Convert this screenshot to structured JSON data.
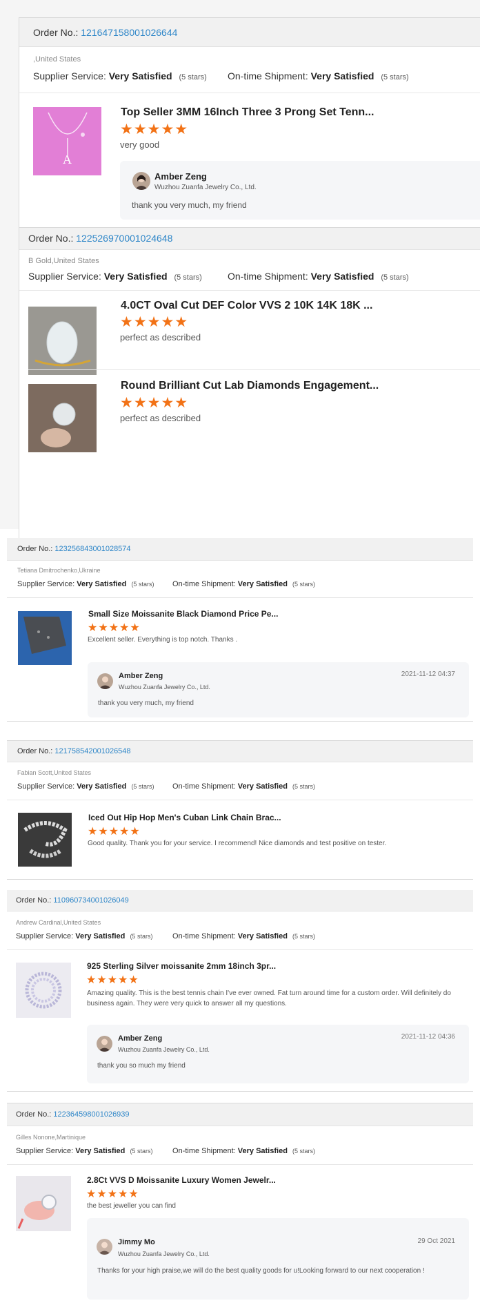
{
  "labels": {
    "order_no": "Order No.:",
    "supplier_service": "Supplier Service:",
    "on_time_shipment": "On-time Shipment:"
  },
  "orders": [
    {
      "order_no": "121647158001026644",
      "location": ",United States",
      "supplier_service": {
        "value": "Very Satisfied",
        "stars_text": "(5 stars)"
      },
      "shipment": {
        "value": "Very Satisfied",
        "stars_text": "(5 stars)"
      },
      "items": [
        {
          "title": "Top Seller 3MM 16Inch Three 3 Prong Set Tenn...",
          "rating": 5,
          "stars": "★★★★★",
          "review": "very good"
        }
      ],
      "reply": {
        "name": "Amber Zeng",
        "company": "Wuzhou Zuanfa Jewelry Co., Ltd.",
        "message": "thank you very much, my friend"
      }
    },
    {
      "order_no": "122526970001024648",
      "location": "B Gold,United States",
      "supplier_service": {
        "value": "Very Satisfied",
        "stars_text": "(5 stars)"
      },
      "shipment": {
        "value": "Very Satisfied",
        "stars_text": "(5 stars)"
      },
      "items": [
        {
          "title": "4.0CT Oval Cut DEF Color VVS 2 10K 14K 18K ...",
          "rating": 5,
          "stars": "★★★★★",
          "review": "perfect as described"
        },
        {
          "title": "Round Brilliant Cut Lab Diamonds Engagement...",
          "rating": 5,
          "stars": "★★★★★",
          "review": "perfect as described"
        }
      ]
    },
    {
      "order_no": "123256843001028574",
      "location": "Tetiana Dmitrochenko,Ukraine",
      "supplier_service": {
        "value": "Very Satisfied",
        "stars_text": "(5 stars)"
      },
      "shipment": {
        "value": "Very Satisfied",
        "stars_text": "(5 stars)"
      },
      "items": [
        {
          "title": "Small Size Moissanite Black Diamond Price Pe...",
          "rating": 5,
          "stars": "★★★★★",
          "review": "Excellent seller. Everything is top notch. Thanks ."
        }
      ],
      "reply": {
        "name": "Amber Zeng",
        "company": "Wuzhou Zuanfa Jewelry Co., Ltd.",
        "date": "2021-11-12 04:37",
        "message": "thank you very much, my friend"
      }
    },
    {
      "order_no": "121758542001026548",
      "location": "Fabian Scott,United States",
      "supplier_service": {
        "value": "Very Satisfied",
        "stars_text": "(5 stars)"
      },
      "shipment": {
        "value": "Very Satisfied",
        "stars_text": "(5 stars)"
      },
      "items": [
        {
          "title": "Iced Out Hip Hop Men's Cuban Link Chain Brac...",
          "rating": 5,
          "stars": "★★★★★",
          "review": "Good quality. Thank you for your service. I recommend! Nice diamonds and test positive on tester."
        }
      ]
    },
    {
      "order_no": "110960734001026049",
      "location": "Andrew Cardinal,United States",
      "supplier_service": {
        "value": "Very Satisfied",
        "stars_text": "(5 stars)"
      },
      "shipment": {
        "value": "Very Satisfied",
        "stars_text": "(5 stars)"
      },
      "items": [
        {
          "title": "925 Sterling Silver moissanite 2mm 18inch 3pr...",
          "rating": 5,
          "stars": "★★★★★",
          "review": "Amazing quality. This is the best tennis chain I've ever owned. Fat turn around time for a custom order. Will definitely do business again. They were very quick to answer all my questions."
        }
      ],
      "reply": {
        "name": "Amber Zeng",
        "company": "Wuzhou Zuanfa Jewelry Co., Ltd.",
        "date": "2021-11-12 04:36",
        "message": "thank you so much my friend"
      }
    },
    {
      "order_no": "122364598001026939",
      "location": "Gilles Nonone,Martinique",
      "supplier_service": {
        "value": "Very Satisfied",
        "stars_text": "(5 stars)"
      },
      "shipment": {
        "value": "Very Satisfied",
        "stars_text": "(5 stars)"
      },
      "items": [
        {
          "title": "2.8Ct VVS D Moissanite Luxury Women Jewelr...",
          "rating": 5,
          "stars": "★★★★★",
          "review": "the best jeweller you can find"
        }
      ],
      "reply": {
        "name": "Jimmy Mo",
        "company": "Wuzhou Zuanfa Jewelry Co., Ltd.",
        "date": "29 Oct 2021",
        "message": "Thanks for your high praise,we will do the best quality goods for u!Looking forward to our next cooperation !"
      }
    }
  ]
}
